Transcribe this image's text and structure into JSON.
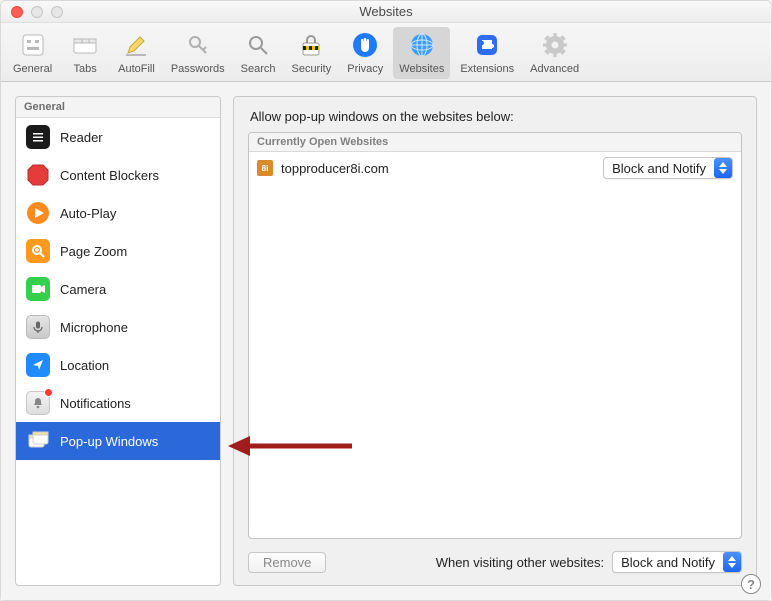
{
  "window": {
    "title": "Websites"
  },
  "toolbar": {
    "items": [
      {
        "key": "general",
        "label": "General"
      },
      {
        "key": "tabs",
        "label": "Tabs"
      },
      {
        "key": "autofill",
        "label": "AutoFill"
      },
      {
        "key": "passwords",
        "label": "Passwords"
      },
      {
        "key": "search",
        "label": "Search"
      },
      {
        "key": "security",
        "label": "Security"
      },
      {
        "key": "privacy",
        "label": "Privacy"
      },
      {
        "key": "websites",
        "label": "Websites",
        "active": true
      },
      {
        "key": "extensions",
        "label": "Extensions"
      },
      {
        "key": "advanced",
        "label": "Advanced"
      }
    ]
  },
  "sidebar": {
    "header": "General",
    "items": [
      {
        "key": "reader",
        "label": "Reader"
      },
      {
        "key": "content-blockers",
        "label": "Content Blockers"
      },
      {
        "key": "auto-play",
        "label": "Auto-Play"
      },
      {
        "key": "page-zoom",
        "label": "Page Zoom"
      },
      {
        "key": "camera",
        "label": "Camera"
      },
      {
        "key": "microphone",
        "label": "Microphone"
      },
      {
        "key": "location",
        "label": "Location"
      },
      {
        "key": "notifications",
        "label": "Notifications",
        "badge": true
      },
      {
        "key": "popup",
        "label": "Pop-up Windows",
        "selected": true
      }
    ]
  },
  "main": {
    "instruction": "Allow pop-up windows on the websites below:",
    "list_header": "Currently Open Websites",
    "rows": [
      {
        "favicon_text": "8i",
        "favicon_bg": "#d98b2a",
        "favicon_fg": "#ffffff",
        "domain": "topproducer8i.com",
        "value": "Block and Notify"
      }
    ],
    "remove_label": "Remove",
    "footer_label": "When visiting other websites:",
    "footer_value": "Block and Notify"
  }
}
